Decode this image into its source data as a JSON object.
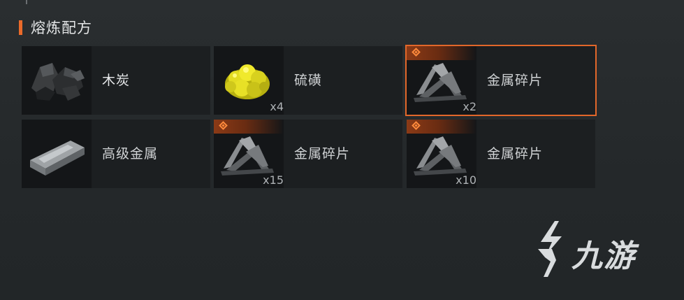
{
  "section": {
    "title": "熔炼配方"
  },
  "recipes": [
    {
      "name": "木炭",
      "qty": "",
      "icon": "charcoal-icon",
      "badge": false,
      "selected": false
    },
    {
      "name": "硫磺",
      "qty": "x4",
      "icon": "sulfur-icon",
      "badge": false,
      "selected": false
    },
    {
      "name": "金属碎片",
      "qty": "x2",
      "icon": "metal-fragments-icon",
      "badge": true,
      "selected": true
    },
    {
      "name": "高级金属",
      "qty": "",
      "icon": "high-quality-metal-icon",
      "badge": false,
      "selected": false
    },
    {
      "name": "金属碎片",
      "qty": "x15",
      "icon": "metal-fragments-icon",
      "badge": true,
      "selected": false
    },
    {
      "name": "金属碎片",
      "qty": "x10",
      "icon": "metal-fragments-icon",
      "badge": true,
      "selected": false
    }
  ],
  "watermark": {
    "text": "九游"
  },
  "colors": {
    "accent": "#ea6a2a",
    "selected_border": "#e2672a",
    "card_bg": "#1c1f21",
    "page_bg": "#262a2c"
  }
}
